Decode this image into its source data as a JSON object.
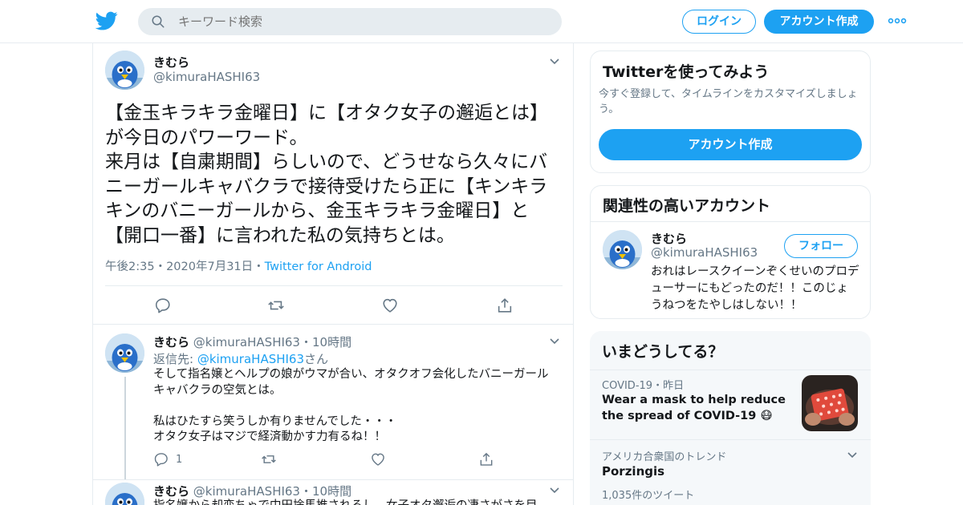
{
  "header": {
    "search_placeholder": "キーワード検索",
    "login_label": "ログイン",
    "signup_label": "アカウント作成",
    "brand_color": "#1da1f2"
  },
  "main_tweet": {
    "name": "きむら",
    "handle": "@kimuraHASHI63",
    "text": "【金玉キラキラ金曜日】に【オタク女子の邂逅とは】が今日のパワーワード。\n来月は【自粛期間】らしいので、どうせなら久々にバニーガールキャバクラで接待受けたら正に【キンキラキンのバニーガールから、金玉キラキラ金曜日】と【開口一番】に言われた私の気持ちとは。",
    "time": "午後2:35",
    "date": "2020年7月31日",
    "source": "Twitter for Android",
    "dot": "・"
  },
  "replies": [
    {
      "name": "きむら",
      "handle": "@kimuraHASHI63",
      "time": "10時間",
      "dot": "・",
      "reply_prefix": "返信先: ",
      "reply_to": "@kimuraHASHI63",
      "reply_suffix": "さん",
      "text": "そして指名嬢とヘルプの娘がウマが合い、オタクオフ会化したバニーガールキャバクラの空気とは。\n\n私はひたすら笑うしか有りませんでした・・・\nオタク女子はマジで経済動かす力有るね！！",
      "reply_count": "1"
    },
    {
      "name": "きむら",
      "handle": "@kimuraHASHI63",
      "time": "10時間",
      "dot": "・",
      "text": "指名嬢から却恋ちゃで中田捨馬推されるし、女子オタ邂逅の凄さがさを目"
    }
  ],
  "sidebar": {
    "signup_card": {
      "title": "Twitterを使ってみよう",
      "description": "今すぐ登録して、タイムラインをカスタマイズしましょう。",
      "button_label": "アカウント作成"
    },
    "related_card": {
      "title": "関連性の高いアカウント",
      "name": "きむら",
      "handle": "@kimuraHASHI63",
      "follow_label": "フォロー",
      "bio": "おれはレースクイーンぞくせいのプロデューサーにもどったのだ！！このじょうねつをたやしはしない！！"
    },
    "trends_card": {
      "title": "いまどうしてる？",
      "news_category": "COVID-19",
      "news_dot": "・",
      "news_time": "昨日",
      "news_headline": "Wear a mask to help reduce the spread of COVID-19 😷",
      "trend_location": "アメリカ合衆国のトレンド",
      "trend_name": "Porzingis",
      "trend_count": "1,035件のツイート"
    }
  }
}
